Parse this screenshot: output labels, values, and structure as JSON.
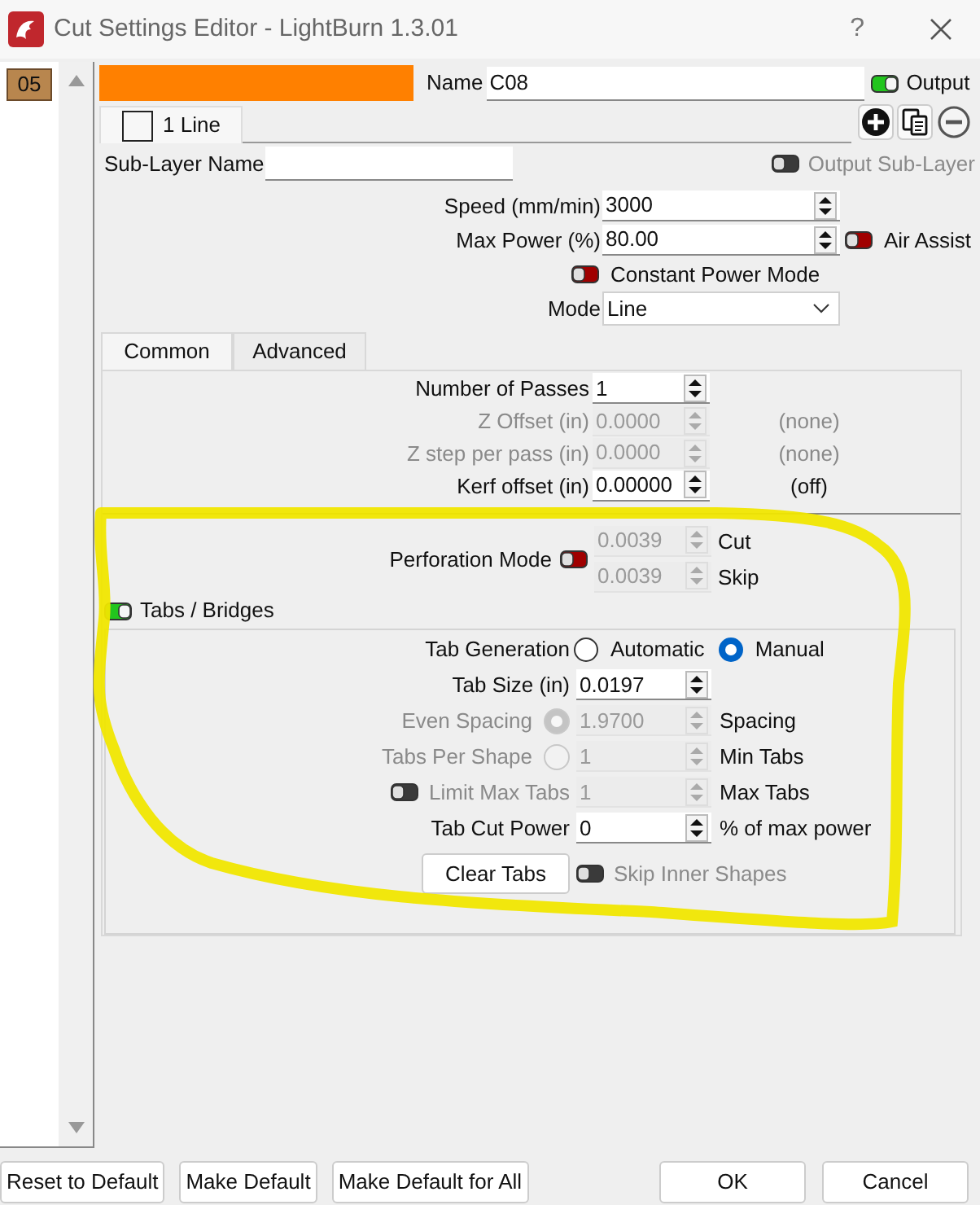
{
  "window": {
    "title": "Cut Settings Editor - LightBurn 1.3.01",
    "help": "?"
  },
  "layers": [
    {
      "label": "05",
      "selected": true,
      "color": "#b8864e"
    }
  ],
  "layer": {
    "color": "#ff8000",
    "name_label": "Name",
    "name": "C08",
    "output": {
      "label": "Output",
      "on": true
    }
  },
  "sublayer_tabs": [
    {
      "label": "1 Line",
      "selected": true,
      "checked": false
    }
  ],
  "sublayer_name": {
    "label": "Sub-Layer Name"
  },
  "output_sublayer": {
    "label": "Output Sub-Layer",
    "on": false,
    "disabled": true
  },
  "settings": [
    {
      "kind": "spin",
      "label": "Speed (mm/min)",
      "value": "3000"
    },
    {
      "kind": "spin",
      "label": "Max Power (%)",
      "value": "80.00",
      "toggle": {
        "label": "Air Assist",
        "on": false
      }
    },
    {
      "kind": "toggle",
      "label": "Constant Power Mode",
      "on": false
    },
    {
      "kind": "dropdown",
      "label": "Mode",
      "value": "Line"
    }
  ],
  "tabs": [
    {
      "label": "Common",
      "selected": true
    },
    {
      "label": "Advanced",
      "selected": false
    }
  ],
  "common": [
    {
      "label": "Number of Passes",
      "value": "1",
      "disabled": false
    },
    {
      "label": "Z Offset (in)",
      "value": "0.0000",
      "disabled": true,
      "note": "(none)"
    },
    {
      "label": "Z step per pass (in)",
      "value": "0.0000",
      "disabled": true,
      "note": "(none)"
    },
    {
      "label": "Kerf offset (in)",
      "value": "0.00000",
      "disabled": false,
      "note": "(off)"
    }
  ],
  "perforation": {
    "label": "Perforation Mode",
    "on": false,
    "fields": [
      {
        "value": "0.0039",
        "label": "Cut",
        "disabled": true
      },
      {
        "value": "0.0039",
        "label": "Skip",
        "disabled": true
      }
    ]
  },
  "tabs_bridges": {
    "label": "Tabs / Bridges",
    "on": true,
    "rows": [
      {
        "kind": "radio_group",
        "label": "Tab Generation",
        "options": [
          {
            "label": "Automatic",
            "selected": false
          },
          {
            "label": "Manual",
            "selected": true
          }
        ]
      },
      {
        "kind": "spin",
        "label": "Tab Size (in)",
        "value": "0.0197",
        "disabled": false
      },
      {
        "kind": "radio_spin",
        "label": "Even Spacing",
        "selected": true,
        "value": "1.9700",
        "suffix": "Spacing",
        "disabled": true
      },
      {
        "kind": "radio_spin",
        "label": "Tabs Per Shape",
        "selected": false,
        "value": "1",
        "suffix": "Min Tabs",
        "disabled": true
      },
      {
        "kind": "toggle_spin",
        "label": "Limit Max Tabs",
        "on": false,
        "value": "1",
        "suffix": "Max Tabs",
        "disabled": true
      },
      {
        "kind": "spin",
        "label": "Tab Cut Power",
        "value": "0",
        "suffix": "% of max power",
        "disabled": false
      },
      {
        "kind": "button_toggle",
        "button": "Clear Tabs",
        "toggle_label": "Skip Inner Shapes",
        "on": false,
        "disabled": true
      }
    ]
  },
  "footer": {
    "left": [
      "Reset to Default",
      "Make Default",
      "Make Default for All"
    ],
    "right": [
      "OK",
      "Cancel"
    ]
  }
}
